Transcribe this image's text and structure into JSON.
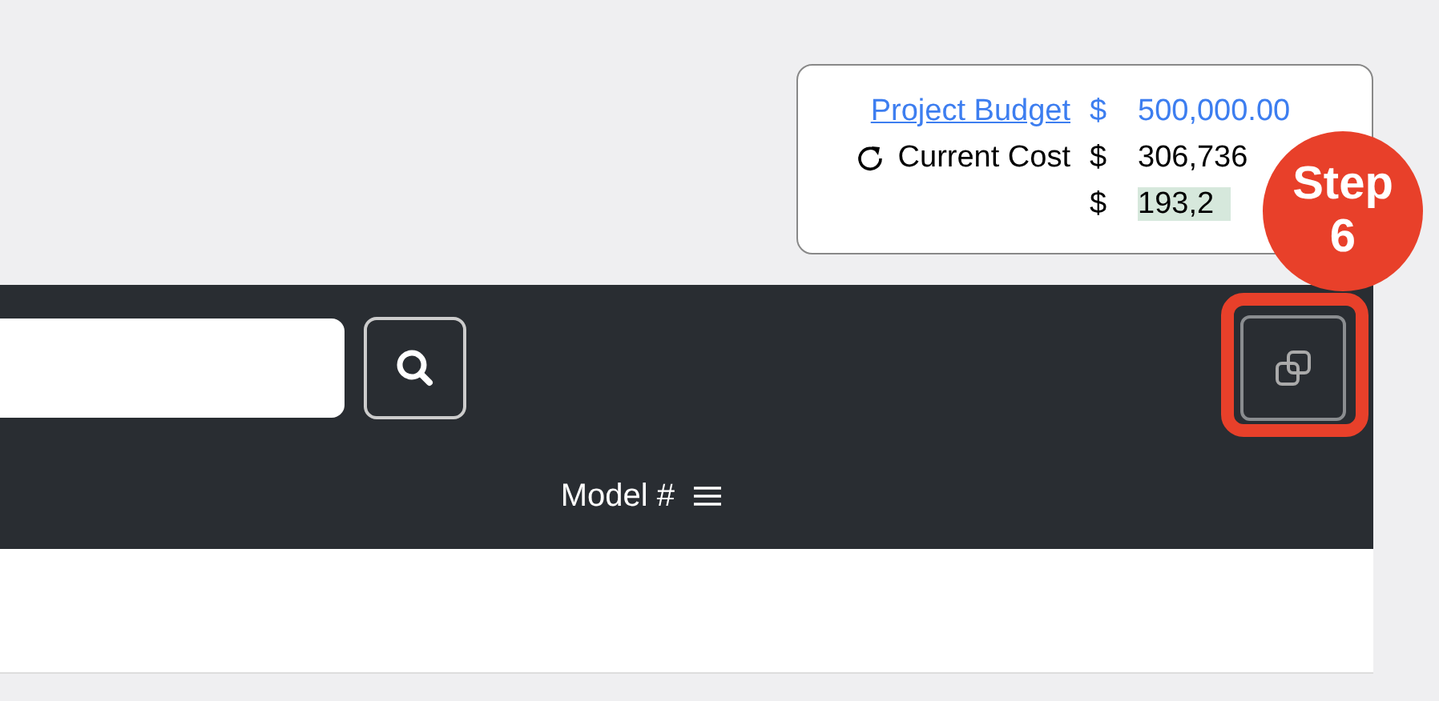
{
  "budget_summary": {
    "rows": [
      {
        "kind": "link",
        "label": "Project Budget",
        "currency": "$",
        "amount": "500,000.00",
        "highlighted": false
      },
      {
        "kind": "refresh",
        "label": "Current Cost",
        "currency": "$",
        "amount": "306,736",
        "highlighted": false
      },
      {
        "kind": "plain",
        "currency": "$",
        "amount": "193,2",
        "highlighted": true
      }
    ]
  },
  "table": {
    "columns": [
      {
        "label": "Model #"
      }
    ]
  },
  "step_badge": {
    "label": "Step",
    "number": "6"
  }
}
